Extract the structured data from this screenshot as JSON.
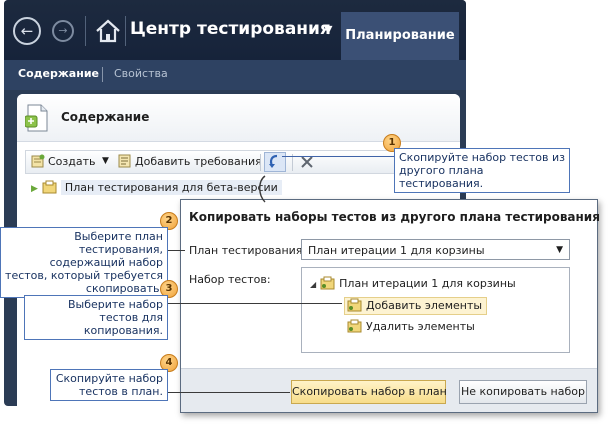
{
  "app": {
    "title": "Центр тестирования",
    "active_tab": "Планирование",
    "subtabs": {
      "content": "Содержание",
      "properties": "Свойства"
    }
  },
  "panel": {
    "title": "Содержание",
    "toolbar": {
      "create": "Создать",
      "add_requirements": "Добавить требования"
    },
    "tree_root": "План тестирования для бета-версии"
  },
  "dialog": {
    "title": "Копировать наборы тестов из другого плана тестирования",
    "plan_label": "План тестирования:",
    "plan_value": "План итерации 1 для корзины",
    "suites_label": "Набор тестов:",
    "suites_root": "План итерации 1 для корзины",
    "suites": [
      "Добавить элементы",
      "Удалить элементы"
    ],
    "copy_button": "Скопировать набор в план",
    "cancel_button": "Не копировать набор"
  },
  "callouts": [
    {
      "number": "1",
      "text": "Скопируйте набор тестов из другого плана тестирования."
    },
    {
      "number": "2",
      "text": "Выберите план тестирования, содержащий набор тестов, который требуется скопировать."
    },
    {
      "number": "3",
      "text": "Выберите набор тестов для копирования."
    },
    {
      "number": "4",
      "text": "Скопируйте набор тестов в план."
    }
  ],
  "colors": {
    "header_bg": "#1d2a3f",
    "callout_border": "#4e75b8",
    "badge": "#f0a23a",
    "primary_button": "#f7dd8a"
  },
  "icons": [
    "back-arrow-icon",
    "forward-arrow-icon",
    "home-icon",
    "document-icon",
    "new-item-icon",
    "requirements-icon",
    "copy-suite-icon",
    "delete-x-icon",
    "test-suite-icon"
  ]
}
